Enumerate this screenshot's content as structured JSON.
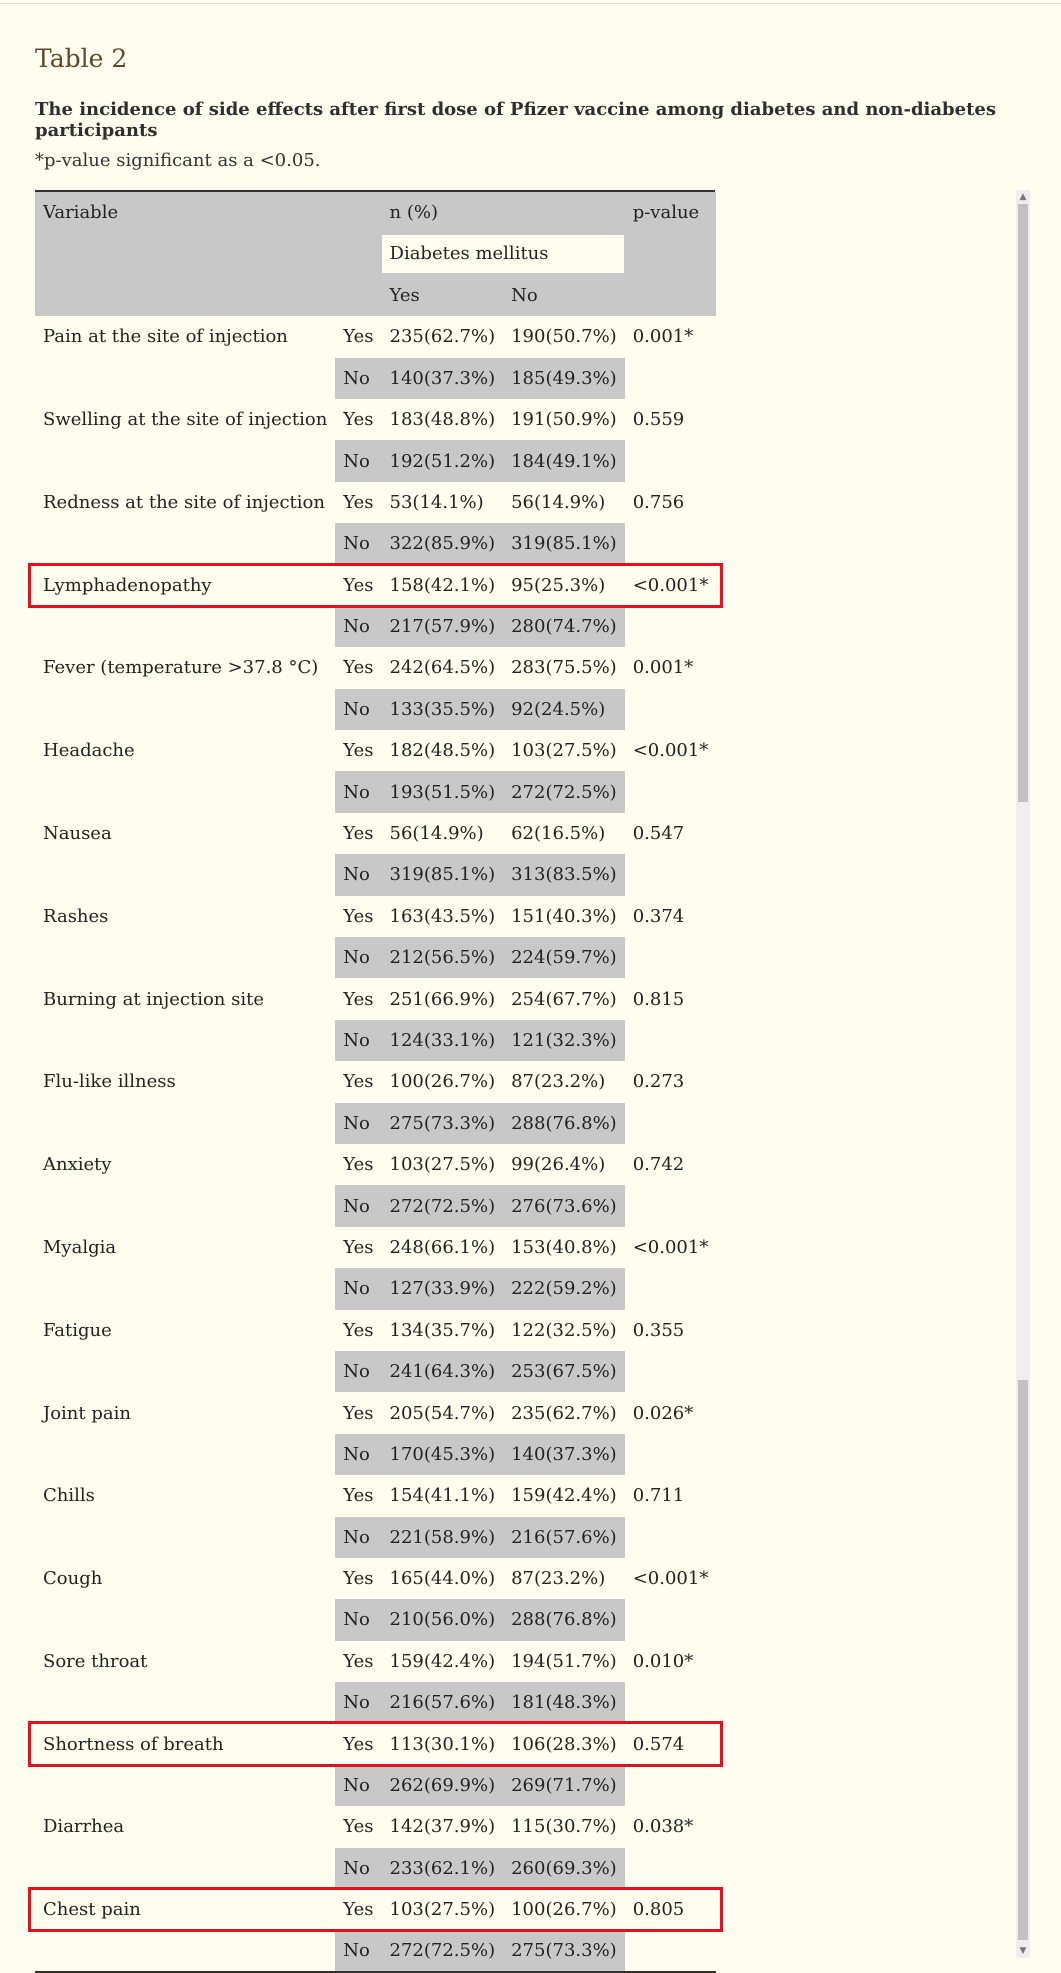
{
  "table_label": "Table 2",
  "caption": "The incidence of side effects after first dose of Pfizer vaccine among diabetes and non-diabetes participants",
  "footnote": "*p-value significant as a <0.05.",
  "header": {
    "variable": "Variable",
    "n_pct": "n (%)",
    "p_value": "p-value",
    "group": "Diabetes mellitus",
    "yes": "Yes",
    "no": "No"
  },
  "rows": [
    {
      "variable": "Pain at the site of injection",
      "yes": {
        "label": "Yes",
        "dm_yes": "235(62.7%)",
        "dm_no": "190(50.7%)"
      },
      "no": {
        "label": "No",
        "dm_yes": "140(37.3%)",
        "dm_no": "185(49.3%)"
      },
      "p": "0.001*"
    },
    {
      "variable": "Swelling at the site of injection",
      "yes": {
        "label": "Yes",
        "dm_yes": "183(48.8%)",
        "dm_no": "191(50.9%)"
      },
      "no": {
        "label": "No",
        "dm_yes": "192(51.2%)",
        "dm_no": "184(49.1%)"
      },
      "p": "0.559"
    },
    {
      "variable": "Redness at the site of injection",
      "yes": {
        "label": "Yes",
        "dm_yes": "53(14.1%)",
        "dm_no": "56(14.9%)"
      },
      "no": {
        "label": "No",
        "dm_yes": "322(85.9%)",
        "dm_no": "319(85.1%)"
      },
      "p": "0.756"
    },
    {
      "variable": "Lymphadenopathy",
      "yes": {
        "label": "Yes",
        "dm_yes": "158(42.1%)",
        "dm_no": "95(25.3%)"
      },
      "no": {
        "label": "No",
        "dm_yes": "217(57.9%)",
        "dm_no": "280(74.7%)"
      },
      "p": "<0.001*"
    },
    {
      "variable": "Fever (temperature >37.8 °C)",
      "yes": {
        "label": "Yes",
        "dm_yes": "242(64.5%)",
        "dm_no": "283(75.5%)"
      },
      "no": {
        "label": "No",
        "dm_yes": "133(35.5%)",
        "dm_no": "92(24.5%)"
      },
      "p": "0.001*"
    },
    {
      "variable": "Headache",
      "yes": {
        "label": "Yes",
        "dm_yes": "182(48.5%)",
        "dm_no": "103(27.5%)"
      },
      "no": {
        "label": "No",
        "dm_yes": "193(51.5%)",
        "dm_no": "272(72.5%)"
      },
      "p": "<0.001*"
    },
    {
      "variable": "Nausea",
      "yes": {
        "label": "Yes",
        "dm_yes": "56(14.9%)",
        "dm_no": "62(16.5%)"
      },
      "no": {
        "label": "No",
        "dm_yes": "319(85.1%)",
        "dm_no": "313(83.5%)"
      },
      "p": "0.547"
    },
    {
      "variable": "Rashes",
      "yes": {
        "label": "Yes",
        "dm_yes": "163(43.5%)",
        "dm_no": "151(40.3%)"
      },
      "no": {
        "label": "No",
        "dm_yes": "212(56.5%)",
        "dm_no": "224(59.7%)"
      },
      "p": "0.374"
    },
    {
      "variable": "Burning at injection site",
      "yes": {
        "label": "Yes",
        "dm_yes": "251(66.9%)",
        "dm_no": "254(67.7%)"
      },
      "no": {
        "label": "No",
        "dm_yes": "124(33.1%)",
        "dm_no": "121(32.3%)"
      },
      "p": "0.815"
    },
    {
      "variable": "Flu-like illness",
      "yes": {
        "label": "Yes",
        "dm_yes": "100(26.7%)",
        "dm_no": "87(23.2%)"
      },
      "no": {
        "label": "No",
        "dm_yes": "275(73.3%)",
        "dm_no": "288(76.8%)"
      },
      "p": "0.273"
    },
    {
      "variable": "Anxiety",
      "yes": {
        "label": "Yes",
        "dm_yes": "103(27.5%)",
        "dm_no": "99(26.4%)"
      },
      "no": {
        "label": "No",
        "dm_yes": "272(72.5%)",
        "dm_no": "276(73.6%)"
      },
      "p": "0.742"
    },
    {
      "variable": "Myalgia",
      "yes": {
        "label": "Yes",
        "dm_yes": "248(66.1%)",
        "dm_no": "153(40.8%)"
      },
      "no": {
        "label": "No",
        "dm_yes": "127(33.9%)",
        "dm_no": "222(59.2%)"
      },
      "p": "<0.001*"
    },
    {
      "variable": "Fatigue",
      "yes": {
        "label": "Yes",
        "dm_yes": "134(35.7%)",
        "dm_no": "122(32.5%)"
      },
      "no": {
        "label": "No",
        "dm_yes": "241(64.3%)",
        "dm_no": "253(67.5%)"
      },
      "p": "0.355"
    },
    {
      "variable": "Joint pain",
      "yes": {
        "label": "Yes",
        "dm_yes": "205(54.7%)",
        "dm_no": "235(62.7%)"
      },
      "no": {
        "label": "No",
        "dm_yes": "170(45.3%)",
        "dm_no": "140(37.3%)"
      },
      "p": "0.026*"
    },
    {
      "variable": "Chills",
      "yes": {
        "label": "Yes",
        "dm_yes": "154(41.1%)",
        "dm_no": "159(42.4%)"
      },
      "no": {
        "label": "No",
        "dm_yes": "221(58.9%)",
        "dm_no": "216(57.6%)"
      },
      "p": "0.711"
    },
    {
      "variable": "Cough",
      "yes": {
        "label": "Yes",
        "dm_yes": "165(44.0%)",
        "dm_no": "87(23.2%)"
      },
      "no": {
        "label": "No",
        "dm_yes": "210(56.0%)",
        "dm_no": "288(76.8%)"
      },
      "p": "<0.001*"
    },
    {
      "variable": "Sore throat",
      "yes": {
        "label": "Yes",
        "dm_yes": "159(42.4%)",
        "dm_no": "194(51.7%)"
      },
      "no": {
        "label": "No",
        "dm_yes": "216(57.6%)",
        "dm_no": "181(48.3%)"
      },
      "p": "0.010*"
    },
    {
      "variable": "Shortness of breath",
      "yes": {
        "label": "Yes",
        "dm_yes": "113(30.1%)",
        "dm_no": "106(28.3%)"
      },
      "no": {
        "label": "No",
        "dm_yes": "262(69.9%)",
        "dm_no": "269(71.7%)"
      },
      "p": "0.574"
    },
    {
      "variable": "Diarrhea",
      "yes": {
        "label": "Yes",
        "dm_yes": "142(37.9%)",
        "dm_no": "115(30.7%)"
      },
      "no": {
        "label": "No",
        "dm_yes": "233(62.1%)",
        "dm_no": "260(69.3%)"
      },
      "p": "0.038*"
    },
    {
      "variable": "Chest pain",
      "yes": {
        "label": "Yes",
        "dm_yes": "103(27.5%)",
        "dm_no": "100(26.7%)"
      },
      "no": {
        "label": "No",
        "dm_yes": "272(72.5%)",
        "dm_no": "275(73.3%)"
      },
      "p": "0.805"
    }
  ],
  "highlighted_variables": [
    "Lymphadenopathy",
    "Shortness of breath",
    "Chest pain"
  ],
  "colors": {
    "background": "#fefdf0",
    "shade": "#c8c8c8",
    "highlight": "#e0141e"
  }
}
